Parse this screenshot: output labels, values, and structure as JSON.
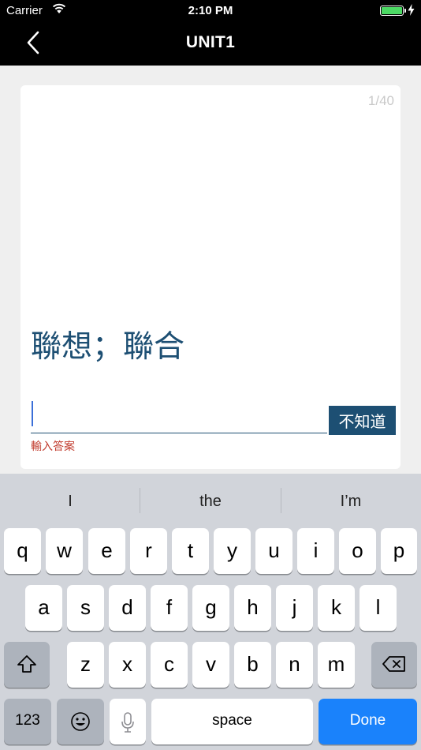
{
  "status_bar": {
    "carrier": "Carrier",
    "time": "2:10 PM",
    "wifi_icon": "wifi-icon",
    "battery_icon": "battery-icon",
    "charging_icon": "bolt-icon"
  },
  "nav": {
    "title": "UNIT1",
    "back_icon": "chevron-left-icon"
  },
  "card": {
    "counter": "1/40",
    "prompt": "聯想；聯合",
    "input_value": "",
    "dont_know_label": "不知道",
    "hint": "輸入答案"
  },
  "keyboard": {
    "suggestions": [
      "I",
      "the",
      "I’m"
    ],
    "row1": [
      "q",
      "w",
      "e",
      "r",
      "t",
      "y",
      "u",
      "i",
      "o",
      "p"
    ],
    "row2": [
      "a",
      "s",
      "d",
      "f",
      "g",
      "h",
      "j",
      "k",
      "l"
    ],
    "row3": [
      "z",
      "x",
      "c",
      "v",
      "b",
      "n",
      "m"
    ],
    "numbers_label": "123",
    "space_label": "space",
    "done_label": "Done",
    "shift_icon": "shift-icon",
    "delete_icon": "backspace-icon",
    "emoji_icon": "emoji-icon",
    "mic_icon": "microphone-icon"
  },
  "colors": {
    "accent": "#1d4f73",
    "hint": "#c0392b",
    "done_key": "#1a82fb",
    "battery": "#4cd964"
  }
}
